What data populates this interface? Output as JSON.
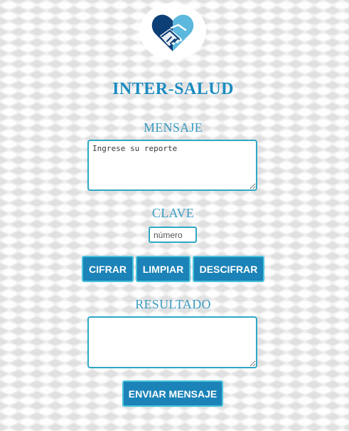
{
  "brand": {
    "title": "INTER-SALUD",
    "logo_icon": "handshake-heart-icon",
    "colors": {
      "dark": "#0d3f77",
      "light": "#5db8de"
    }
  },
  "mensaje": {
    "label": "MENSAJE",
    "placeholder": "Ingrese su reporte",
    "value": ""
  },
  "clave": {
    "label": "CLAVE",
    "placeholder": "número",
    "value": ""
  },
  "actions": {
    "cifrar_label": "CIFRAR",
    "limpiar_label": "LIMPIAR",
    "descifrar_label": "DESCIFRAR"
  },
  "resultado": {
    "label": "RESULTADO",
    "value": ""
  },
  "enviar": {
    "label": "ENVIAR MENSAJE"
  },
  "theme": {
    "accent": "#1b83b8",
    "border": "#2fa8c6",
    "title_color": "#1b8bc0"
  }
}
